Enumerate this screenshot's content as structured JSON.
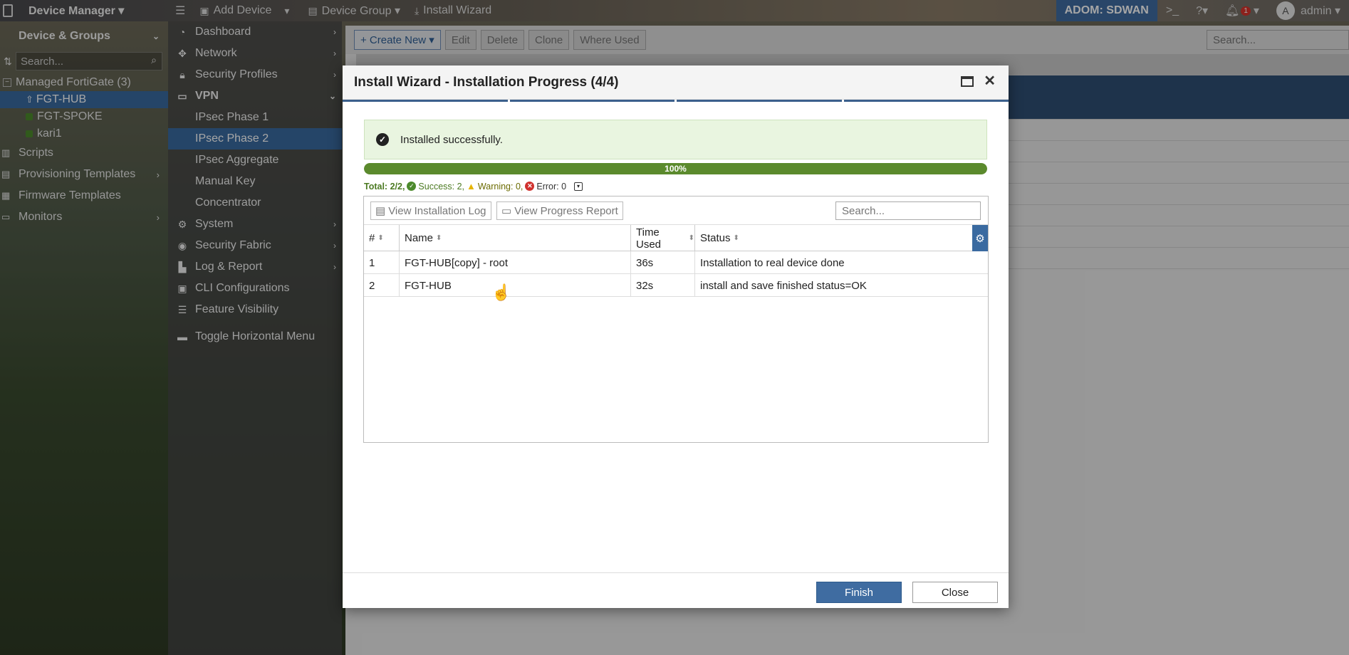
{
  "topbar": {
    "app_title": "Device Manager ▾",
    "menu_icon": "hamburger-icon",
    "add_device": "Add Device",
    "device_group": "Device Group ▾",
    "install_wizard": "Install Wizard",
    "adom": "ADOM: SDWAN",
    "notif_count": "1",
    "avatar_letter": "A",
    "user": "admin ▾"
  },
  "sidebar": {
    "header": "Device & Groups",
    "search_placeholder": "Search...",
    "group": "Managed FortiGate (3)",
    "devices": [
      "FGT-HUB",
      "FGT-SPOKE",
      "kari1"
    ],
    "menu": [
      "Scripts",
      "Provisioning Templates",
      "Firmware Templates",
      "Monitors"
    ]
  },
  "nav2": {
    "dashboard": "Dashboard",
    "network": "Network",
    "security_profiles": "Security Profiles",
    "vpn": "VPN",
    "ipsec_phase1": "IPsec Phase 1",
    "ipsec_phase2": "IPsec Phase 2",
    "ipsec_aggregate": "IPsec Aggregate",
    "manual_key": "Manual Key",
    "concentrator": "Concentrator",
    "system": "System",
    "security_fabric": "Security Fabric",
    "log_report": "Log & Report",
    "cli_config": "CLI Configurations",
    "feature_visibility": "Feature Visibility",
    "toggle_menu": "Toggle Horizontal Menu"
  },
  "main": {
    "create_new": "+ Create New ▾",
    "edit": "Edit",
    "delete": "Delete",
    "clone": "Clone",
    "where_used": "Where Used",
    "search_placeholder": "Search..."
  },
  "modal": {
    "title": "Install Wizard - Installation Progress (4/4)",
    "success_message": "Installed successfully.",
    "progress_label": "100%",
    "progress_value": 100,
    "total": "Total: 2/2,",
    "success": "Success: 2,",
    "warning": "Warning: 0,",
    "error": "Error: 0",
    "view_log": "View Installation Log",
    "view_report": "View Progress Report",
    "search_placeholder": "Search...",
    "columns": [
      "#",
      "Name",
      "Time Used",
      "Status"
    ],
    "rows": [
      {
        "num": "1",
        "name": "FGT-HUB[copy] - root",
        "time": "36s",
        "status": "Installation to real device done"
      },
      {
        "num": "2",
        "name": "FGT-HUB",
        "time": "32s",
        "status": "install and save finished status=OK"
      }
    ],
    "finish": "Finish",
    "close": "Close"
  },
  "colors": {
    "accent": "#3f6ca1",
    "success": "#5b8a2d",
    "error": "#d0312d",
    "warning": "#e6b400"
  }
}
